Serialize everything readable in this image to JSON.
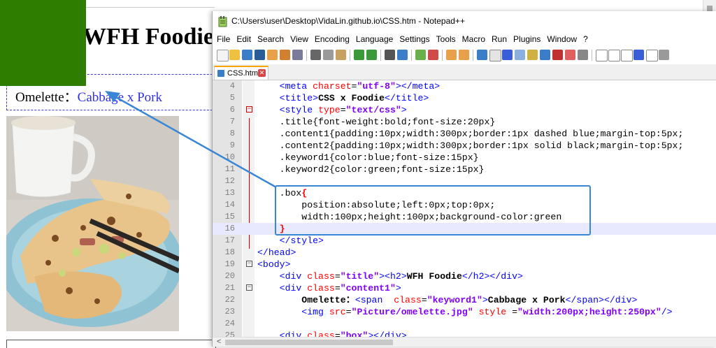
{
  "preview": {
    "heading": "WFH Foodie",
    "omelette_label": "Omelette：",
    "keyword": "Cabbage x Pork",
    "photo_alt": "omelette"
  },
  "notepad": {
    "title": "C:\\Users\\user\\Desktop\\VidaLin.github.io\\CSS.htm - Notepad++",
    "menu": [
      "File",
      "Edit",
      "Search",
      "View",
      "Encoding",
      "Language",
      "Settings",
      "Tools",
      "Macro",
      "Run",
      "Plugins",
      "Window",
      "?"
    ],
    "tab_label": "CSS.htm",
    "tab_close": "✕",
    "line_numbers": [
      "4",
      "5",
      "6",
      "7",
      "8",
      "9",
      "10",
      "11",
      "12",
      "13",
      "14",
      "15",
      "16",
      "17",
      "18",
      "19",
      "20",
      "21",
      "22",
      "23",
      "24",
      "25"
    ],
    "code": {
      "l4": [
        "<meta ",
        "charset",
        "=",
        "\"utf-8\"",
        "></meta>"
      ],
      "l5a": "<title>",
      "l5b": "CSS x Foodie",
      "l5c": "</title>",
      "l6a": "<style ",
      "l6b": "type",
      "l6c": "=",
      "l6d": "\"text/css\"",
      "l6e": ">",
      "l7": ".title{font-weight:bold;font-size:20px}",
      "l8": ".content1{padding:10px;width:300px;border:1px dashed blue;margin-top:5px;",
      "l9": ".content2{padding:10px;width:300px;border:1px solid black;margin-top:5px;",
      "l10": ".keyword1{color:blue;font-size:15px}",
      "l11": ".keyword2{color:green;font-size:15px}",
      "l13a": ".box",
      "l13b": "{",
      "l14": "    position:absolute;left:0px;top:0px;",
      "l15": "    width:100px;height:100px;background-color:green",
      "l16": "}",
      "l17": "</style>",
      "l18": "</head>",
      "l19": "<body>",
      "l20a": "<div ",
      "l20b": "class",
      "l20c": "=",
      "l20d": "\"title\"",
      "l20e": "><h2>",
      "l20f": "WFH Foodie",
      "l20g": "</h2></div>",
      "l21a": "<div ",
      "l21b": "class",
      "l21c": "=",
      "l21d": "\"content1\"",
      "l21e": ">",
      "l22a": "    Omelette：",
      "l22b": "<span  ",
      "l22c": "class",
      "l22d": "=",
      "l22e": "\"keyword1\"",
      "l22f": ">",
      "l22g": "Cabbage x Pork",
      "l22h": "</span></div>",
      "l23a": "    <img ",
      "l23b": "src",
      "l23c": "=",
      "l23d": "\"Picture/omelette.jpg\"",
      "l23e": " style ",
      "l23f": "=",
      "l23g": "\"width:200px;height:250px\"",
      "l23h": "/>",
      "l25a": "<div ",
      "l25b": "class",
      "l25c": "=",
      "l25d": "\"box\"",
      "l25e": "></div>"
    }
  },
  "colors": {
    "green_box": "#2e7d00",
    "keyword_blue": "#3030e0",
    "highlight_blue": "#3a86d6",
    "tab_accent": "#f6a600"
  }
}
